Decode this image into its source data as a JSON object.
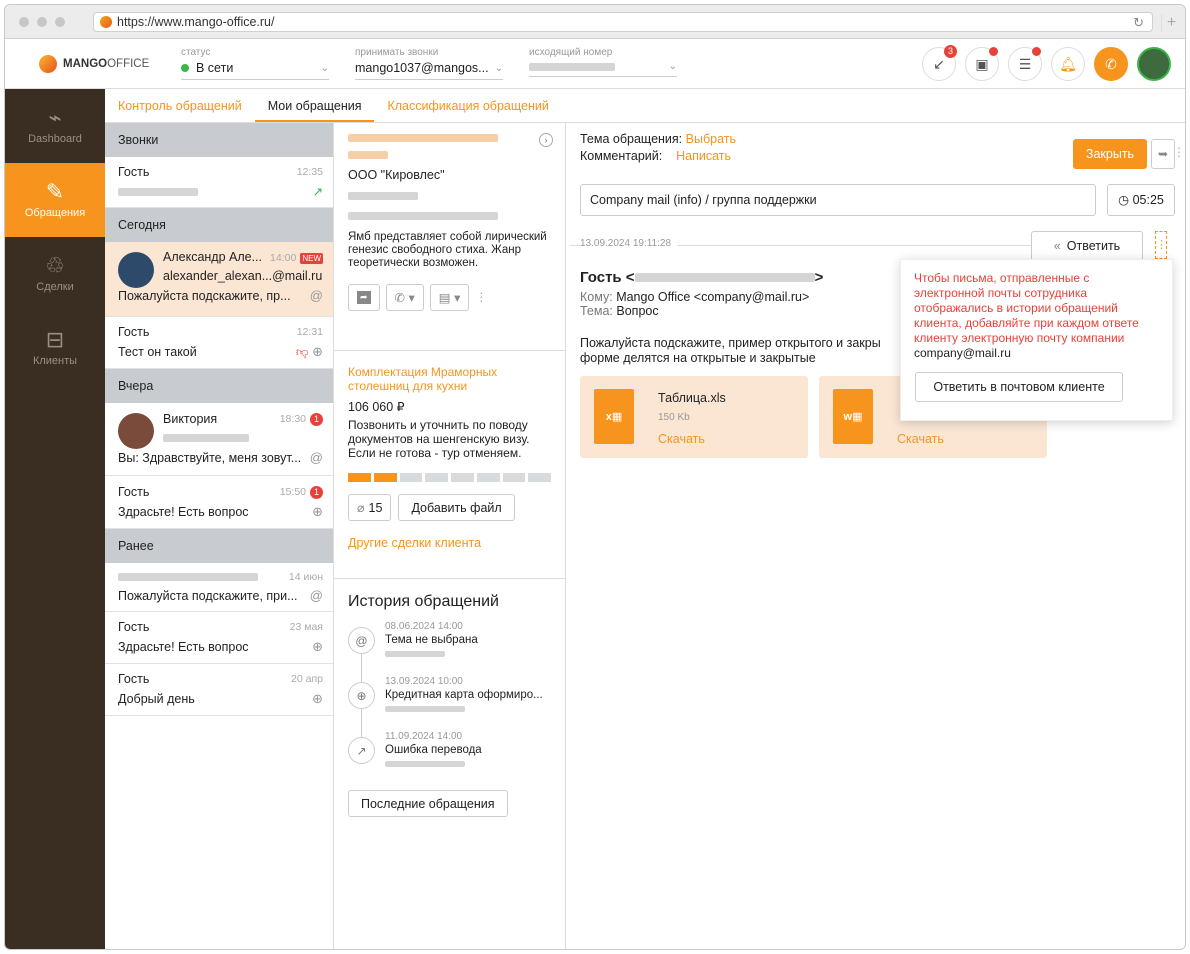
{
  "browser": {
    "url": "https://www.mango-office.ru/"
  },
  "header": {
    "logo_brand": "MANGO",
    "logo_suffix": "OFFICE",
    "status_label": "статус",
    "status_value": "В сети",
    "calls_label": "принимать звонки",
    "calls_value": "mango1037@mangos...",
    "outgoing_label": "исходящий номер",
    "missed_badge": "3"
  },
  "sidebar": {
    "items": [
      {
        "label": "Dashboard",
        "icon": "dashboard-icon"
      },
      {
        "label": "Обращения",
        "icon": "edit-icon"
      },
      {
        "label": "Сделки",
        "icon": "handshake-icon"
      },
      {
        "label": "Клиенты",
        "icon": "briefcase-icon"
      }
    ]
  },
  "tabs": [
    "Контроль обращений",
    "Мои обращения",
    "Классификация обращений"
  ],
  "list": {
    "sections": [
      "Звонки",
      "Сегодня",
      "Вчера",
      "Ранее"
    ],
    "calls": [
      {
        "name": "Гость",
        "time": "12:35"
      }
    ],
    "today": [
      {
        "name": "Александр Але...",
        "time": "14:00",
        "badge": "NEW",
        "email": "alexander_alexan...@mail.ru",
        "text": "Пожалуйста подскажите, пр..."
      },
      {
        "name": "Гость",
        "time": "12:31",
        "text": "Тест он такой"
      }
    ],
    "yesterday": [
      {
        "name": "Виктория",
        "time": "18:30",
        "count": "1",
        "text": "Вы: Здравствуйте, меня зовут..."
      },
      {
        "name": "Гость",
        "time": "15:50",
        "count": "1",
        "text": "Здрасьте! Есть вопрос"
      }
    ],
    "earlier": [
      {
        "time": "14 июн",
        "text": "Пожалуйста подскажите, при..."
      },
      {
        "name": "Гость",
        "time": "23 мая",
        "text": "Здрасьте! Есть вопрос"
      },
      {
        "name": "Гость",
        "time": "20 апр",
        "text": "Добрый день"
      }
    ]
  },
  "contact": {
    "company": "ООО \"Кировлес\"",
    "description": "Ямб представляет собой лирический генезис свободного стиха. Жанр теоретически возможен."
  },
  "deal": {
    "title": "Комплектация Мраморных столешниц для кухни",
    "amount": "106 060 ₽",
    "description": "Позвонить  и уточнить по поводу документов на шенгенскую визу. Если не готова - тур отменяем.",
    "progress_steps": 8,
    "progress_done": 2,
    "attachments": "15",
    "add_file": "Добавить файл",
    "other_deals": "Другие сделки клиента"
  },
  "history": {
    "title": "История обращений",
    "items": [
      {
        "date": "08.06.2024 14:00",
        "text": "Тема не выбрана",
        "icon": "at-icon"
      },
      {
        "date": "13.09.2024 10:00",
        "text": "Кредитная карта оформиро...",
        "icon": "globe-icon"
      },
      {
        "date": "11.09.2024 14:00",
        "text": "Ошибка перевода",
        "icon": "arrow-out-icon"
      }
    ],
    "last_button": "Последние обращения"
  },
  "detail": {
    "topic_label": "Тема обращения:",
    "topic_action": "Выбрать",
    "comment_label": "Комментарий:",
    "comment_action": "Написать",
    "close_button": "Закрыть",
    "subject": "Company mail (info) / группа поддержки",
    "timer": "05:25",
    "message_date": "13.09.2024 19:11:28",
    "reply_button": "Ответить",
    "from_prefix": "Гость <",
    "from_suffix": ">",
    "to_label": "Кому:",
    "to_value": "Mango Office <company@mail.ru>",
    "topic2_label": "Тема:",
    "topic2_value": "Вопрос",
    "body": "Пожалуйста подскажите, пример открытого и закрь форме делятся на открытые и закрытые",
    "body_line1": "Пожалуйста подскажите, пример открытого и закры",
    "body_line2": "форме делятся на открытые и закрытые",
    "attachments": [
      {
        "name": "Таблица.xls",
        "size": "150 Kb",
        "action": "Скачать",
        "type": "x"
      },
      {
        "action": "Скачать",
        "type": "w"
      }
    ]
  },
  "tooltip": {
    "text": "Чтобы письма, отправленные с электронной почты сотрудника отображались в истории обращений клиента, добавляйте при каждом ответе клиенту электронную почту компании",
    "email": "company@mail.ru",
    "button": "Ответить в почтовом клиенте"
  }
}
